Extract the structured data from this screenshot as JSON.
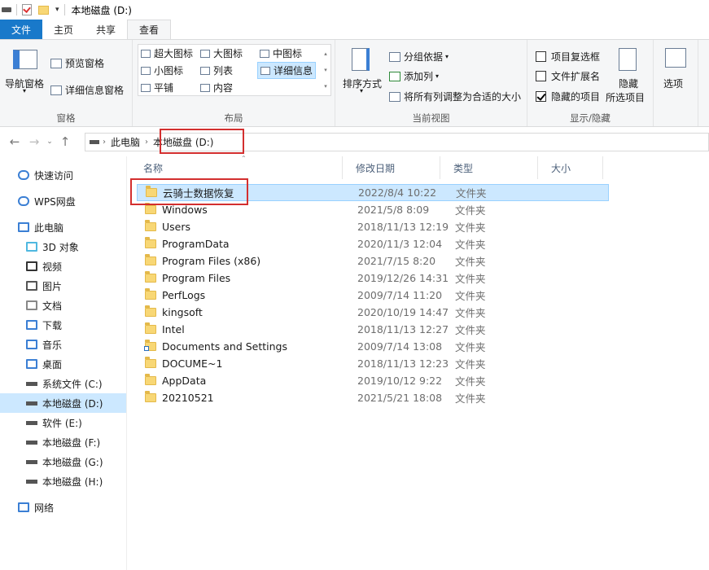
{
  "title": {
    "path": "本地磁盘 (D:)"
  },
  "tabs": [
    "文件",
    "主页",
    "共享",
    "查看"
  ],
  "ribbon": {
    "panes": {
      "nav_pane": "导航窗格",
      "preview": "预览窗格",
      "details": "详细信息窗格",
      "label": "窗格"
    },
    "layout": {
      "items": [
        "超大图标",
        "大图标",
        "中图标",
        "小图标",
        "列表",
        "详细信息",
        "平铺",
        "内容"
      ],
      "selected": "详细信息",
      "label": "布局"
    },
    "current_view": {
      "sort": "排序方式",
      "group_by": "分组依据",
      "add_col": "添加列",
      "fit_cols": "将所有列调整为合适的大小",
      "label": "当前视图"
    },
    "show_hide": {
      "item_checkbox": "项目复选框",
      "item_checkbox_checked": false,
      "file_ext": "文件扩展名",
      "file_ext_checked": false,
      "hidden_items": "隐藏的项目",
      "hidden_items_checked": true,
      "hide_selected_1": "隐藏",
      "hide_selected_2": "所选项目",
      "label": "显示/隐藏"
    },
    "options": "选项"
  },
  "address": {
    "crumbs": [
      "此电脑",
      "本地磁盘 (D:)"
    ]
  },
  "nav": [
    {
      "label": "快速访问",
      "icon": "star-icon"
    },
    {
      "label": "WPS网盘",
      "icon": "cloud-icon"
    },
    {
      "label": "此电脑",
      "icon": "computer-icon"
    },
    {
      "label": "3D 对象",
      "icon": "cube-icon"
    },
    {
      "label": "视频",
      "icon": "video-icon"
    },
    {
      "label": "图片",
      "icon": "picture-icon"
    },
    {
      "label": "文档",
      "icon": "document-icon"
    },
    {
      "label": "下载",
      "icon": "download-icon"
    },
    {
      "label": "音乐",
      "icon": "music-icon"
    },
    {
      "label": "桌面",
      "icon": "desktop-icon"
    },
    {
      "label": "系统文件 (C:)",
      "icon": "drive-icon"
    },
    {
      "label": "本地磁盘 (D:)",
      "icon": "drive-icon"
    },
    {
      "label": "软件 (E:)",
      "icon": "drive-icon"
    },
    {
      "label": "本地磁盘 (F:)",
      "icon": "drive-icon"
    },
    {
      "label": "本地磁盘 (G:)",
      "icon": "drive-icon"
    },
    {
      "label": "本地磁盘 (H:)",
      "icon": "drive-icon"
    },
    {
      "label": "网络",
      "icon": "network-icon"
    }
  ],
  "columns": [
    "名称",
    "修改日期",
    "类型",
    "大小"
  ],
  "files": [
    {
      "name": "云骑士数据恢复",
      "date": "2022/8/4 10:22",
      "type": "文件夹"
    },
    {
      "name": "Windows",
      "date": "2021/5/8 8:09",
      "type": "文件夹"
    },
    {
      "name": "Users",
      "date": "2018/11/13 12:19",
      "type": "文件夹"
    },
    {
      "name": "ProgramData",
      "date": "2020/11/3 12:04",
      "type": "文件夹"
    },
    {
      "name": "Program Files (x86)",
      "date": "2021/7/15 8:20",
      "type": "文件夹"
    },
    {
      "name": "Program Files",
      "date": "2019/12/26 14:31",
      "type": "文件夹"
    },
    {
      "name": "PerfLogs",
      "date": "2009/7/14 11:20",
      "type": "文件夹"
    },
    {
      "name": "kingsoft",
      "date": "2020/10/19 14:47",
      "type": "文件夹"
    },
    {
      "name": "Intel",
      "date": "2018/11/13 12:27",
      "type": "文件夹"
    },
    {
      "name": "Documents and Settings",
      "date": "2009/7/14 13:08",
      "type": "文件夹"
    },
    {
      "name": "DOCUME~1",
      "date": "2018/11/13 12:23",
      "type": "文件夹"
    },
    {
      "name": "AppData",
      "date": "2019/10/12 9:22",
      "type": "文件夹"
    },
    {
      "name": "20210521",
      "date": "2021/5/21 18:08",
      "type": "文件夹"
    }
  ]
}
